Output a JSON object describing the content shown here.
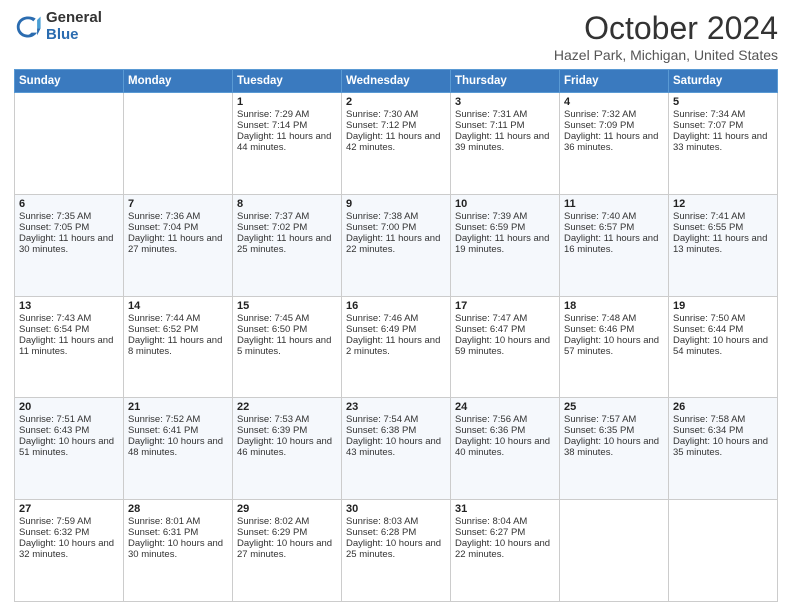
{
  "header": {
    "logo_general": "General",
    "logo_blue": "Blue",
    "title": "October 2024",
    "location": "Hazel Park, Michigan, United States"
  },
  "days_of_week": [
    "Sunday",
    "Monday",
    "Tuesday",
    "Wednesday",
    "Thursday",
    "Friday",
    "Saturday"
  ],
  "weeks": [
    [
      {
        "day": "",
        "sunrise": "",
        "sunset": "",
        "daylight": ""
      },
      {
        "day": "",
        "sunrise": "",
        "sunset": "",
        "daylight": ""
      },
      {
        "day": "1",
        "sunrise": "Sunrise: 7:29 AM",
        "sunset": "Sunset: 7:14 PM",
        "daylight": "Daylight: 11 hours and 44 minutes."
      },
      {
        "day": "2",
        "sunrise": "Sunrise: 7:30 AM",
        "sunset": "Sunset: 7:12 PM",
        "daylight": "Daylight: 11 hours and 42 minutes."
      },
      {
        "day": "3",
        "sunrise": "Sunrise: 7:31 AM",
        "sunset": "Sunset: 7:11 PM",
        "daylight": "Daylight: 11 hours and 39 minutes."
      },
      {
        "day": "4",
        "sunrise": "Sunrise: 7:32 AM",
        "sunset": "Sunset: 7:09 PM",
        "daylight": "Daylight: 11 hours and 36 minutes."
      },
      {
        "day": "5",
        "sunrise": "Sunrise: 7:34 AM",
        "sunset": "Sunset: 7:07 PM",
        "daylight": "Daylight: 11 hours and 33 minutes."
      }
    ],
    [
      {
        "day": "6",
        "sunrise": "Sunrise: 7:35 AM",
        "sunset": "Sunset: 7:05 PM",
        "daylight": "Daylight: 11 hours and 30 minutes."
      },
      {
        "day": "7",
        "sunrise": "Sunrise: 7:36 AM",
        "sunset": "Sunset: 7:04 PM",
        "daylight": "Daylight: 11 hours and 27 minutes."
      },
      {
        "day": "8",
        "sunrise": "Sunrise: 7:37 AM",
        "sunset": "Sunset: 7:02 PM",
        "daylight": "Daylight: 11 hours and 25 minutes."
      },
      {
        "day": "9",
        "sunrise": "Sunrise: 7:38 AM",
        "sunset": "Sunset: 7:00 PM",
        "daylight": "Daylight: 11 hours and 22 minutes."
      },
      {
        "day": "10",
        "sunrise": "Sunrise: 7:39 AM",
        "sunset": "Sunset: 6:59 PM",
        "daylight": "Daylight: 11 hours and 19 minutes."
      },
      {
        "day": "11",
        "sunrise": "Sunrise: 7:40 AM",
        "sunset": "Sunset: 6:57 PM",
        "daylight": "Daylight: 11 hours and 16 minutes."
      },
      {
        "day": "12",
        "sunrise": "Sunrise: 7:41 AM",
        "sunset": "Sunset: 6:55 PM",
        "daylight": "Daylight: 11 hours and 13 minutes."
      }
    ],
    [
      {
        "day": "13",
        "sunrise": "Sunrise: 7:43 AM",
        "sunset": "Sunset: 6:54 PM",
        "daylight": "Daylight: 11 hours and 11 minutes."
      },
      {
        "day": "14",
        "sunrise": "Sunrise: 7:44 AM",
        "sunset": "Sunset: 6:52 PM",
        "daylight": "Daylight: 11 hours and 8 minutes."
      },
      {
        "day": "15",
        "sunrise": "Sunrise: 7:45 AM",
        "sunset": "Sunset: 6:50 PM",
        "daylight": "Daylight: 11 hours and 5 minutes."
      },
      {
        "day": "16",
        "sunrise": "Sunrise: 7:46 AM",
        "sunset": "Sunset: 6:49 PM",
        "daylight": "Daylight: 11 hours and 2 minutes."
      },
      {
        "day": "17",
        "sunrise": "Sunrise: 7:47 AM",
        "sunset": "Sunset: 6:47 PM",
        "daylight": "Daylight: 10 hours and 59 minutes."
      },
      {
        "day": "18",
        "sunrise": "Sunrise: 7:48 AM",
        "sunset": "Sunset: 6:46 PM",
        "daylight": "Daylight: 10 hours and 57 minutes."
      },
      {
        "day": "19",
        "sunrise": "Sunrise: 7:50 AM",
        "sunset": "Sunset: 6:44 PM",
        "daylight": "Daylight: 10 hours and 54 minutes."
      }
    ],
    [
      {
        "day": "20",
        "sunrise": "Sunrise: 7:51 AM",
        "sunset": "Sunset: 6:43 PM",
        "daylight": "Daylight: 10 hours and 51 minutes."
      },
      {
        "day": "21",
        "sunrise": "Sunrise: 7:52 AM",
        "sunset": "Sunset: 6:41 PM",
        "daylight": "Daylight: 10 hours and 48 minutes."
      },
      {
        "day": "22",
        "sunrise": "Sunrise: 7:53 AM",
        "sunset": "Sunset: 6:39 PM",
        "daylight": "Daylight: 10 hours and 46 minutes."
      },
      {
        "day": "23",
        "sunrise": "Sunrise: 7:54 AM",
        "sunset": "Sunset: 6:38 PM",
        "daylight": "Daylight: 10 hours and 43 minutes."
      },
      {
        "day": "24",
        "sunrise": "Sunrise: 7:56 AM",
        "sunset": "Sunset: 6:36 PM",
        "daylight": "Daylight: 10 hours and 40 minutes."
      },
      {
        "day": "25",
        "sunrise": "Sunrise: 7:57 AM",
        "sunset": "Sunset: 6:35 PM",
        "daylight": "Daylight: 10 hours and 38 minutes."
      },
      {
        "day": "26",
        "sunrise": "Sunrise: 7:58 AM",
        "sunset": "Sunset: 6:34 PM",
        "daylight": "Daylight: 10 hours and 35 minutes."
      }
    ],
    [
      {
        "day": "27",
        "sunrise": "Sunrise: 7:59 AM",
        "sunset": "Sunset: 6:32 PM",
        "daylight": "Daylight: 10 hours and 32 minutes."
      },
      {
        "day": "28",
        "sunrise": "Sunrise: 8:01 AM",
        "sunset": "Sunset: 6:31 PM",
        "daylight": "Daylight: 10 hours and 30 minutes."
      },
      {
        "day": "29",
        "sunrise": "Sunrise: 8:02 AM",
        "sunset": "Sunset: 6:29 PM",
        "daylight": "Daylight: 10 hours and 27 minutes."
      },
      {
        "day": "30",
        "sunrise": "Sunrise: 8:03 AM",
        "sunset": "Sunset: 6:28 PM",
        "daylight": "Daylight: 10 hours and 25 minutes."
      },
      {
        "day": "31",
        "sunrise": "Sunrise: 8:04 AM",
        "sunset": "Sunset: 6:27 PM",
        "daylight": "Daylight: 10 hours and 22 minutes."
      },
      {
        "day": "",
        "sunrise": "",
        "sunset": "",
        "daylight": ""
      },
      {
        "day": "",
        "sunrise": "",
        "sunset": "",
        "daylight": ""
      }
    ]
  ]
}
